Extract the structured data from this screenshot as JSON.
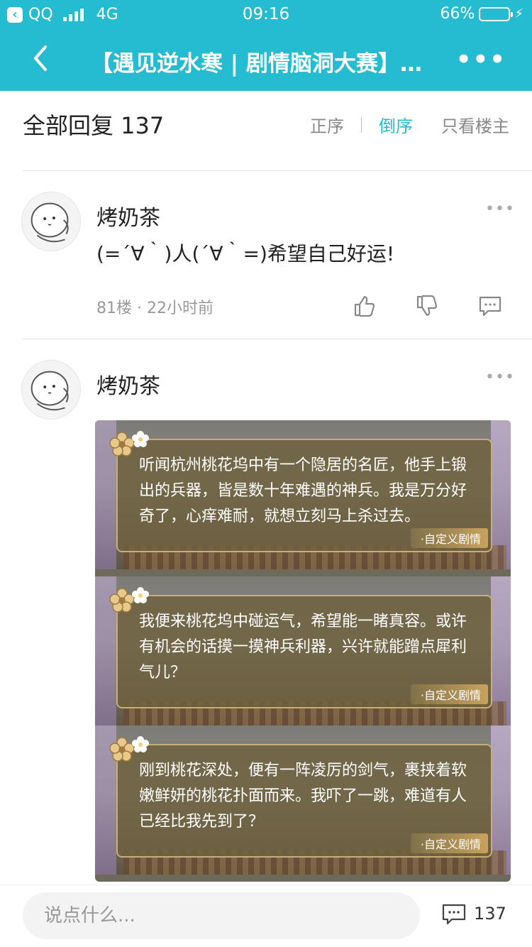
{
  "status": {
    "carrier": "QQ",
    "network": "4G",
    "time": "09:16",
    "battery": "66%",
    "battery_level": 0.66
  },
  "nav": {
    "title": "【遇见逆水寒 | 剧情脑洞大赛】…",
    "more": "•••"
  },
  "sortbar": {
    "count_label": "全部回复 137",
    "asc": "正序",
    "desc": "倒序",
    "owner_only": "只看楼主"
  },
  "posts": [
    {
      "username": "烤奶茶",
      "content": "(=´∀｀)人(´∀｀=)希望自己好运!",
      "meta": "81楼 · 22小时前",
      "dots": "•••"
    },
    {
      "username": "烤奶茶",
      "dots": "•••",
      "images": [
        {
          "text": "听闻杭州桃花坞中有一个隐居的名匠，他手上锻出的兵器，皆是数十年难遇的神兵。我是万分好奇了，心痒难耐，就想立刻马上杀过去。",
          "tag": "·自定义剧情"
        },
        {
          "text": "我便来桃花坞中碰运气，希望能一睹真容。或许有机会的话摸一摸神兵利器，兴许就能蹭点犀利气儿？",
          "tag": "·自定义剧情"
        },
        {
          "text": "刚到桃花深处，便有一阵凌厉的剑气，裹挟着软嫩鲜妍的桃花扑面而来。我吓了一跳，难道有人已经比我先到了？",
          "tag": "·自定义剧情"
        }
      ]
    }
  ],
  "bottombar": {
    "placeholder": "说点什么...",
    "comment_count": "137"
  },
  "colors": {
    "brand": "#25bcd1",
    "battery": "#4cd964"
  }
}
